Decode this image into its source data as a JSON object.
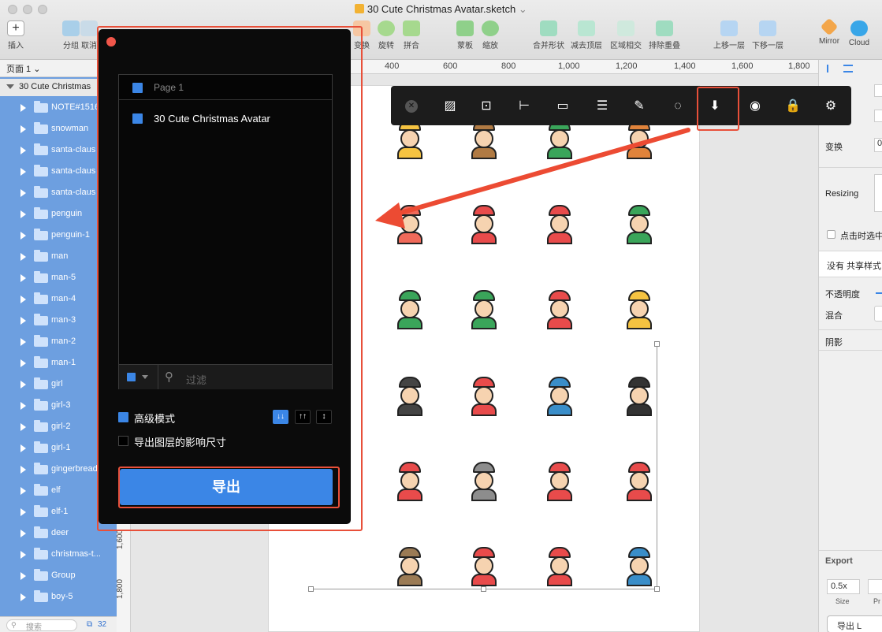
{
  "window": {
    "title": "30 Cute Christmas Avatar.sketch",
    "title_suffix": "⌄"
  },
  "toolbar_main": {
    "insert": "插入",
    "group": "分组",
    "cancel": "取消",
    "transform": "变换",
    "rotate": "旋转",
    "combine": "拼合",
    "mask": "蒙板",
    "scale": "缩放",
    "union": "合并形状",
    "subtract": "减去顶层",
    "intersect": "区域相交",
    "difference": "排除重叠",
    "forward": "上移一层",
    "backward": "下移一层",
    "mirror": "Mirror",
    "cloud": "Cloud"
  },
  "sidebar": {
    "page_select": "页面 1",
    "page_caret": "⌄",
    "document": "30 Cute Christmas",
    "layers": [
      "NOTE#1516",
      "snowman",
      "santa-claus",
      "santa-claus",
      "santa-claus",
      "penguin",
      "penguin-1",
      "man",
      "man-5",
      "man-4",
      "man-3",
      "man-2",
      "man-1",
      "girl",
      "girl-3",
      "girl-2",
      "girl-1",
      "gingerbread",
      "elf",
      "elf-1",
      "deer",
      "christmas-t...",
      "Group",
      "boy-5"
    ],
    "search_placeholder": "搜索",
    "count": "32"
  },
  "ruler": {
    "top": [
      "400",
      "600",
      "800",
      "1,000",
      "1,200",
      "1,400",
      "1,600",
      "1,800"
    ],
    "left": [
      "1,600",
      "1,800"
    ]
  },
  "float_toolbar": {
    "icons": [
      "close-icon",
      "hatch-icon",
      "artboard-icon",
      "slice-icon",
      "comment-icon",
      "list-icon",
      "brush-icon",
      "drop-icon",
      "export-icon",
      "eye-icon",
      "lock-icon",
      "gear-icon"
    ]
  },
  "export_panel": {
    "tree_header": "Page 1",
    "tree_item": "30 Cute Christmas Avatar",
    "filter_placeholder": "过滤",
    "advanced_mode": "高级模式",
    "export_influence": "导出图层的影响尺寸",
    "export_button": "导出",
    "sort_down": "↓↓",
    "sort_up": "↑↑",
    "sort_az": "↕"
  },
  "inspector": {
    "transform": "变换",
    "resizing": "Resizing",
    "click_select": "点击时选中",
    "no_shared": "没有 共享样式",
    "opacity": "不透明度",
    "blend": "混合",
    "shadow": "阴影",
    "export": "Export",
    "scale": "0.5x",
    "size": "Size",
    "prefix": "Pr",
    "export_layer_btn": "导出 L",
    "transform_value": "0"
  },
  "colors": {
    "accent": "#3b86e6",
    "highlight": "#e8503a",
    "sidebar": "#6d9fe0"
  }
}
